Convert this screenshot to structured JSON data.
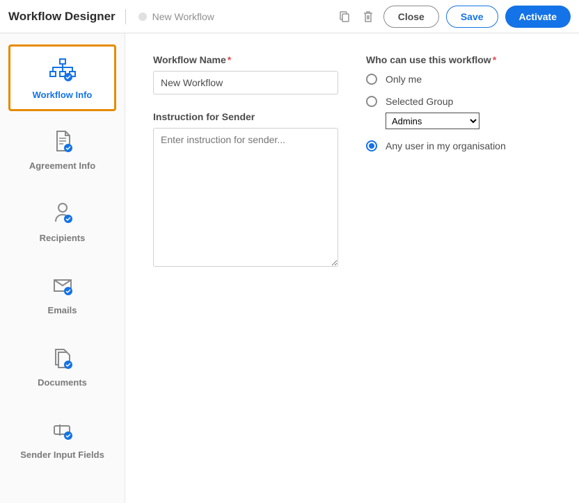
{
  "header": {
    "title": "Workflow Designer",
    "breadcrumb": "New Workflow",
    "actions": {
      "close": "Close",
      "save": "Save",
      "activate": "Activate"
    }
  },
  "sidebar": {
    "items": [
      {
        "id": "workflow-info",
        "label": "Workflow Info",
        "active": true
      },
      {
        "id": "agreement-info",
        "label": "Agreement Info",
        "active": false
      },
      {
        "id": "recipients",
        "label": "Recipients",
        "active": false
      },
      {
        "id": "emails",
        "label": "Emails",
        "active": false
      },
      {
        "id": "documents",
        "label": "Documents",
        "active": false
      },
      {
        "id": "sender-input-fields",
        "label": "Sender Input Fields",
        "active": false
      }
    ]
  },
  "form": {
    "workflow_name_label": "Workflow Name",
    "workflow_name_value": "New Workflow",
    "instruction_label": "Instruction for Sender",
    "instruction_placeholder": "Enter instruction for sender...",
    "who_can_use_label": "Who can use this workflow",
    "options": {
      "only_me": "Only me",
      "selected_group": "Selected Group",
      "selected_group_value": "Admins",
      "any_user": "Any user in my organisation"
    },
    "selected_option": "any_user"
  }
}
